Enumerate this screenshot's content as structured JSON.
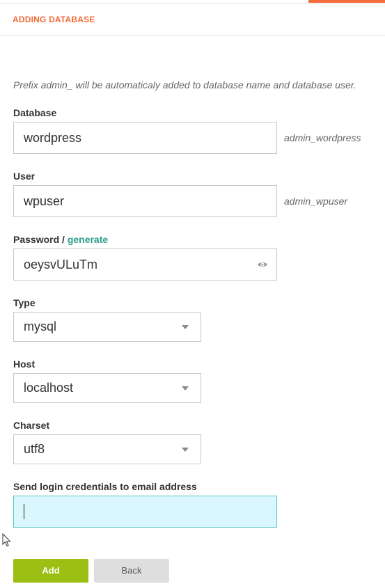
{
  "header": {
    "title": "ADDING DATABASE"
  },
  "prefix_note": "Prefix admin_ will be automaticaly added to database name and database user.",
  "database": {
    "label": "Database",
    "value": "wordpress",
    "suffix": "admin_wordpress"
  },
  "user": {
    "label": "User",
    "value": "wpuser",
    "suffix": "admin_wpuser"
  },
  "password": {
    "label": "Password /",
    "generate_link": "generate",
    "value": "oeysvULuTm",
    "icon": "eye-icon"
  },
  "type": {
    "label": "Type",
    "value": "mysql",
    "icon": "chevron-down-icon"
  },
  "host": {
    "label": "Host",
    "value": "localhost",
    "icon": "chevron-down-icon"
  },
  "charset": {
    "label": "Charset",
    "value": "utf8",
    "icon": "chevron-down-icon"
  },
  "email": {
    "label": "Send login credentials to email address",
    "value": ""
  },
  "buttons": {
    "add": "Add",
    "back": "Back"
  },
  "colors": {
    "accent": "#f26b3a",
    "link": "#2a9d8f",
    "add_button": "#9bbf13",
    "email_focus_bg": "#d9f7fd"
  }
}
